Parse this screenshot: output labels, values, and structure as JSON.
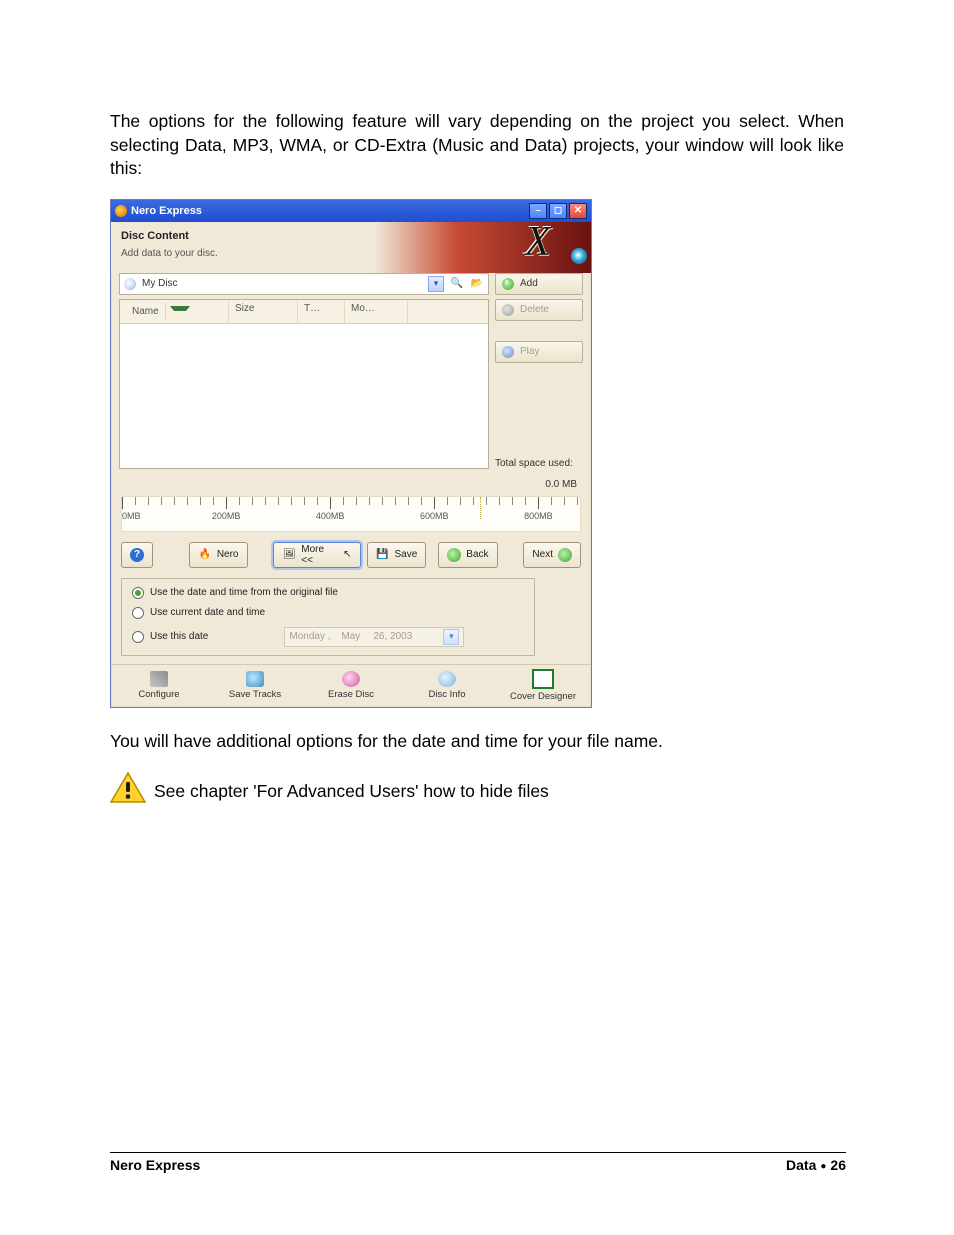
{
  "paragraphs": {
    "p1": "The options for the following feature will vary depending on the project you select. When selecting Data, MP3, WMA, or CD-Extra (Music and Data) projects, your window will look like this:",
    "p2": "You will have additional options for the date and time for your file name.",
    "p3": "See chapter 'For Advanced Users' how to hide files"
  },
  "window": {
    "title": "Nero Express",
    "header_title": "Disc Content",
    "header_sub": "Add data to your disc.",
    "path_value": "My Disc",
    "columns": {
      "name": "Name",
      "size": "Size",
      "type": "T…",
      "modified": "Mo…"
    },
    "side_buttons": {
      "add": "Add",
      "delete": "Delete",
      "play": "Play"
    },
    "total_space_label": "Total space used:",
    "total_space_value": "0.0 MB",
    "ruler_labels": [
      "0MB",
      "200MB",
      "400MB",
      "600MB",
      "800MB"
    ],
    "nav_buttons": {
      "nero": "Nero",
      "more": "More <<",
      "save": "Save",
      "back": "Back",
      "next": "Next"
    },
    "options": {
      "opt1": "Use the date and time from the original file",
      "opt2": "Use current date and time",
      "opt3": "Use this date",
      "date_weekday": "Monday  ,",
      "date_month": "May",
      "date_rest": "26, 2003"
    },
    "bottom": {
      "configure": "Configure",
      "save_tracks": "Save Tracks",
      "erase": "Erase Disc",
      "info": "Disc Info",
      "cover": "Cover Designer"
    }
  },
  "footer": {
    "left": "Nero Express",
    "right_section": "Data",
    "right_page": "26"
  }
}
